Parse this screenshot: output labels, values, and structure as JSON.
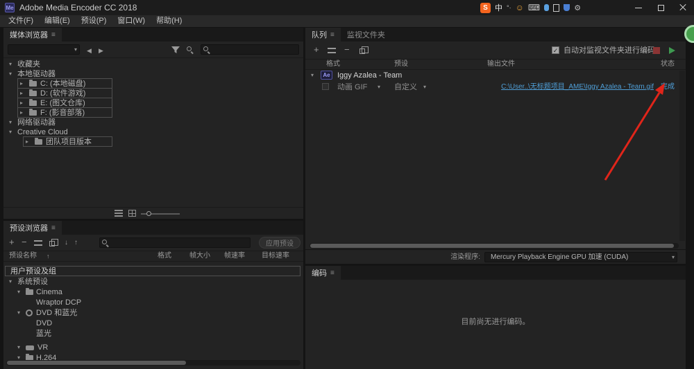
{
  "window": {
    "app_icon": "Me",
    "title": "Adobe Media Encoder CC 2018"
  },
  "tray": {
    "sogou": "S",
    "lang": "中",
    "mode": "°·",
    "emoji": "☺",
    "keyboard": "⌨"
  },
  "menu": {
    "items": [
      {
        "label": "文件(F)"
      },
      {
        "label": "编辑(E)"
      },
      {
        "label": "预设(P)"
      },
      {
        "label": "窗口(W)"
      },
      {
        "label": "帮助(H)"
      }
    ]
  },
  "icons": {
    "menu_glyph": "≡",
    "expanded": "▾",
    "collapsed": "▸",
    "dropdown": "▾",
    "back": "◀",
    "forward": "▶",
    "add": "+",
    "remove": "−",
    "check": "✓",
    "sort_up": "↑",
    "import_arrow": "↓",
    "export_arrow": "↑",
    "gear": "⚙"
  },
  "media_browser": {
    "title": "媒体浏览器",
    "tree": [
      {
        "label": "收藏夹"
      },
      {
        "label": "本地驱动器"
      },
      {
        "label": "C: (本地磁盘)"
      },
      {
        "label": "D: (软件游戏)"
      },
      {
        "label": "E: (图文仓库)"
      },
      {
        "label": "F: (影音部落)"
      },
      {
        "label": "网络驱动器"
      },
      {
        "label": "Creative Cloud"
      },
      {
        "label": "团队项目版本"
      }
    ]
  },
  "preset_browser": {
    "title": "预设浏览器",
    "apply_button": "应用预设",
    "columns": [
      "预设名称",
      "格式",
      "帧大小",
      "帧速率",
      "目标速率"
    ],
    "tree": [
      {
        "label": "用户预设及组"
      },
      {
        "label": "系统预设"
      },
      {
        "label": "Cinema"
      },
      {
        "label": "Wraptor DCP"
      },
      {
        "label": "DVD 和蓝光"
      },
      {
        "label": "DVD"
      },
      {
        "label": "蓝光"
      },
      {
        "label": "VR"
      },
      {
        "label": "H.264"
      }
    ]
  },
  "queue": {
    "tab_queue": "队列",
    "tab_watch": "监视文件夹",
    "auto_encode": "自动对监视文件夹进行编码",
    "columns": [
      "格式",
      "预设",
      "输出文件",
      "状态"
    ],
    "group": {
      "badge": "Ae",
      "name": "Iggy Azalea - Team"
    },
    "item": {
      "format": "动画 GIF",
      "preset": "自定义",
      "output": "C:\\User..\\无标题项目_AME\\Iggy Azalea - Team.gif",
      "status": "完成"
    },
    "renderer_label": "渲染程序:",
    "renderer_value": "Mercury Playback Engine GPU 加速 (CUDA)"
  },
  "encoder": {
    "title": "编码",
    "empty_message": "目前尚无进行编码。"
  }
}
